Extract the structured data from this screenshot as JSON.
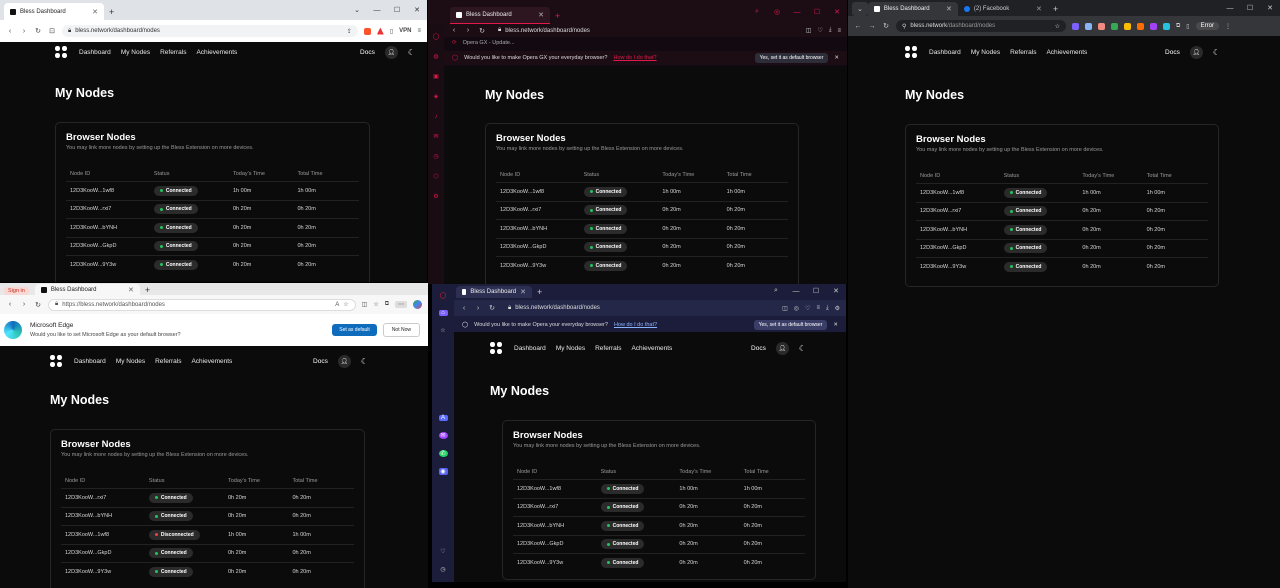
{
  "windows": {
    "w1": {
      "tab_title": "Bless Dashboard",
      "url": "bless.network/dashboard/nodes",
      "vpn_label": "VPN"
    },
    "w2": {
      "tab_title": "Bless Dashboard",
      "url": "bless.network/dashboard/nodes",
      "update_text": "Opera GX - Update...",
      "prompt_text": "Would you like to make Opera GX your everyday browser?",
      "prompt_link": "How do I do that?",
      "prompt_button": "Yes, set it as default browser"
    },
    "w3": {
      "tab_title": "Bless Dashboard",
      "tab2_title": "(2) Facebook",
      "url_host": "bless.network",
      "url_path": "/dashboard/nodes",
      "error_label": "Error"
    },
    "w4": {
      "signin_label": "Sign in",
      "tab_title": "Bless Dashboard",
      "url": "https://bless.network/dashboard/nodes",
      "infobar_title": "Microsoft Edge",
      "infobar_text": "Would you like to set Microsoft Edge as your default browser?",
      "set_default_button": "Set as default",
      "not_now_button": "Not Now"
    },
    "w5": {
      "tab_title": "Bless Dashboard",
      "url": "bless.network/dashboard/nodes",
      "prompt_text": "Would you like to make Opera your everyday browser?",
      "prompt_link": "How do I do that?",
      "prompt_button": "Yes, set it as default browser"
    }
  },
  "site": {
    "nav": [
      "Dashboard",
      "My Nodes",
      "Referrals",
      "Achievements"
    ],
    "docs_label": "Docs",
    "page_title": "My Nodes",
    "card_title": "Browser Nodes",
    "card_subtitle": "You may link more nodes by setting up the Bless Extension on more devices.",
    "columns": [
      "Node ID",
      "Status",
      "Today's Time",
      "Total Time"
    ]
  },
  "tables": {
    "standard": [
      {
        "id": "12D3KooW...1wf8",
        "status": "Connected",
        "today": "1h 00m",
        "total": "1h 00m"
      },
      {
        "id": "12D3KooW...rxi7",
        "status": "Connected",
        "today": "0h 20m",
        "total": "0h 20m"
      },
      {
        "id": "12D3KooW...bYNH",
        "status": "Connected",
        "today": "0h 20m",
        "total": "0h 20m"
      },
      {
        "id": "12D3KooW...GkpD",
        "status": "Connected",
        "today": "0h 20m",
        "total": "0h 20m"
      },
      {
        "id": "12D3KooW...9Y3w",
        "status": "Connected",
        "today": "0h 20m",
        "total": "0h 20m"
      }
    ],
    "edge": [
      {
        "id": "12D3KooW...rxi7",
        "status": "Connected",
        "today": "0h 20m",
        "total": "0h 20m"
      },
      {
        "id": "12D3KooW...bYNH",
        "status": "Connected",
        "today": "0h 20m",
        "total": "0h 20m"
      },
      {
        "id": "12D3KooW...1wf8",
        "status": "Disconnected",
        "today": "1h 00m",
        "total": "1h 00m"
      },
      {
        "id": "12D3KooW...GkpD",
        "status": "Connected",
        "today": "0h 20m",
        "total": "0h 20m"
      },
      {
        "id": "12D3KooW...9Y3w",
        "status": "Connected",
        "today": "0h 20m",
        "total": "0h 20m"
      }
    ]
  },
  "colors": {
    "connected": "#22c55e",
    "disconnected": "#ef4444",
    "opera_gx_accent": "#e0194a",
    "edge_blue": "#0f6cbd"
  }
}
